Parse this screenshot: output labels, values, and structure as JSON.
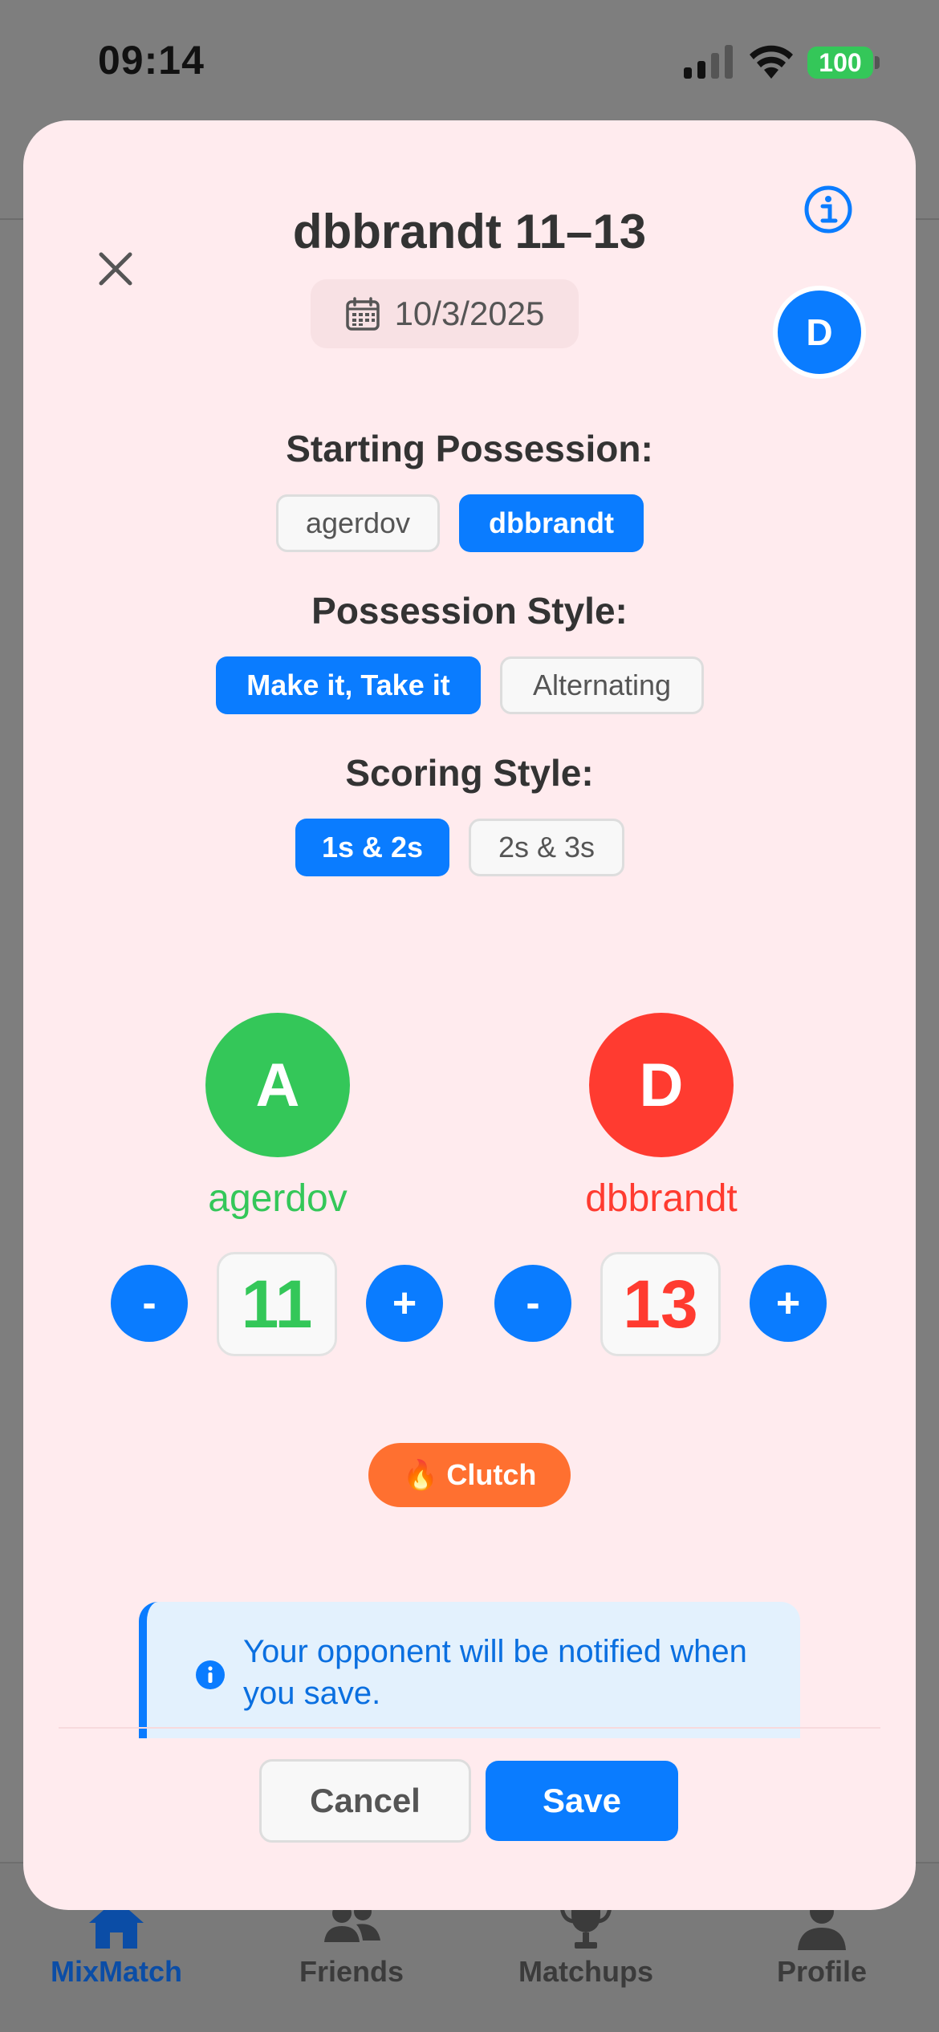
{
  "status_bar": {
    "time": "09:14",
    "battery": "100"
  },
  "tabs": [
    {
      "label": "MixMatch",
      "icon": "home-icon",
      "active": true
    },
    {
      "label": "Friends",
      "icon": "people-icon",
      "active": false
    },
    {
      "label": "Matchups",
      "icon": "trophy-icon",
      "active": false
    },
    {
      "label": "Profile",
      "icon": "person-icon",
      "active": false
    }
  ],
  "modal": {
    "title": "dbbrandt 11–13",
    "date": "10/3/2025",
    "avatar_initial": "D",
    "starting_possession": {
      "label": "Starting Possession:",
      "options": [
        "agerdov",
        "dbbrandt"
      ],
      "selected": "dbbrandt"
    },
    "possession_style": {
      "label": "Possession Style:",
      "options": [
        "Make it, Take it",
        "Alternating"
      ],
      "selected": "Make it, Take it"
    },
    "scoring_style": {
      "label": "Scoring Style:",
      "options": [
        "1s & 2s",
        "2s & 3s"
      ],
      "selected": "1s & 2s"
    },
    "players": [
      {
        "initial": "A",
        "name": "agerdov",
        "score": "11",
        "color": "#34c759"
      },
      {
        "initial": "D",
        "name": "dbbrandt",
        "score": "13",
        "color": "#ff3b30"
      }
    ],
    "stepper": {
      "minus": "-",
      "plus": "+"
    },
    "clutch_badge": {
      "emoji": "🔥",
      "label": "Clutch"
    },
    "notice": "Your opponent will be notified when you save.",
    "cancel_label": "Cancel",
    "save_label": "Save"
  },
  "colors": {
    "accent": "#0a7cff",
    "modal_bg": "#ffebee",
    "clutch": "#ff7030"
  }
}
